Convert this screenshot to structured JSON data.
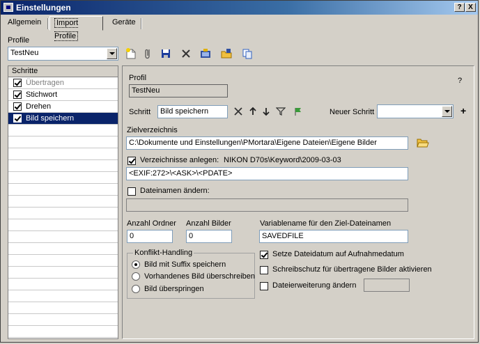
{
  "window": {
    "title": "Einstellungen",
    "help_btn": "?",
    "close_btn": "X"
  },
  "tabs": [
    {
      "label": "Allgemein"
    },
    {
      "label": "Import Profile"
    },
    {
      "label": "Geräte"
    }
  ],
  "profile": {
    "label": "Profile",
    "selected": "TestNeu"
  },
  "toolbar_icons": [
    "new-icon",
    "attach-icon",
    "save-icon",
    "delete-icon",
    "export-icon",
    "import-icon",
    "copy-icon"
  ],
  "steps": {
    "header": "Schritte",
    "items": [
      {
        "label": "Übertragen",
        "checked": true,
        "disabled": true
      },
      {
        "label": "Stichwort",
        "checked": true
      },
      {
        "label": "Drehen",
        "checked": true
      },
      {
        "label": "Bild speichern",
        "checked": true,
        "selected": true
      }
    ]
  },
  "main": {
    "profile_label": "Profil",
    "profile_value": "TestNeu",
    "help": "?",
    "schritt_label": "Schritt",
    "schritt_value": "Bild speichern",
    "neuer_schritt_label": "Neuer Schritt",
    "neuer_schritt_value": "",
    "add": "+",
    "zielverzeichnis_label": "Zielverzeichnis",
    "zielverzeichnis_value": "C:\\Dokumente und Einstellungen\\PMortara\\Eigene Dateien\\Eigene Bilder",
    "verzeichnisse_label": "Verzeichnisse anlegen:",
    "verzeichnisse_preview": "NIKON D70s\\Keyword\\2009-03-03",
    "verzeichnisse_value": "<EXIF:272>\\<ASK>\\<PDATE>",
    "dateinamen_label": "Dateinamen ändern:",
    "dateinamen_value": "",
    "anzahl_ordner_label": "Anzahl Ordner",
    "anzahl_ordner_value": "0",
    "anzahl_bilder_label": "Anzahl Bilder",
    "anzahl_bilder_value": "0",
    "variablename_label": "Variablename für den  Ziel-Dateinamen",
    "variablename_value": "SAVEDFILE",
    "konflikt": {
      "label": "Konflikt-Handling",
      "options": [
        {
          "label": "Bild mit Suffix speichern",
          "selected": true
        },
        {
          "label": "Vorhandenes Bild überschreiben",
          "selected": false
        },
        {
          "label": "Bild überspringen",
          "selected": false
        }
      ]
    },
    "options": [
      {
        "label": "Setze Dateidatum auf Aufnahmedatum",
        "checked": true
      },
      {
        "label": "Schreibschutz für übertragene Bilder aktivieren",
        "checked": false
      },
      {
        "label": "Dateierweiterung ändern",
        "checked": false
      }
    ],
    "dateierweiterung_value": ""
  }
}
